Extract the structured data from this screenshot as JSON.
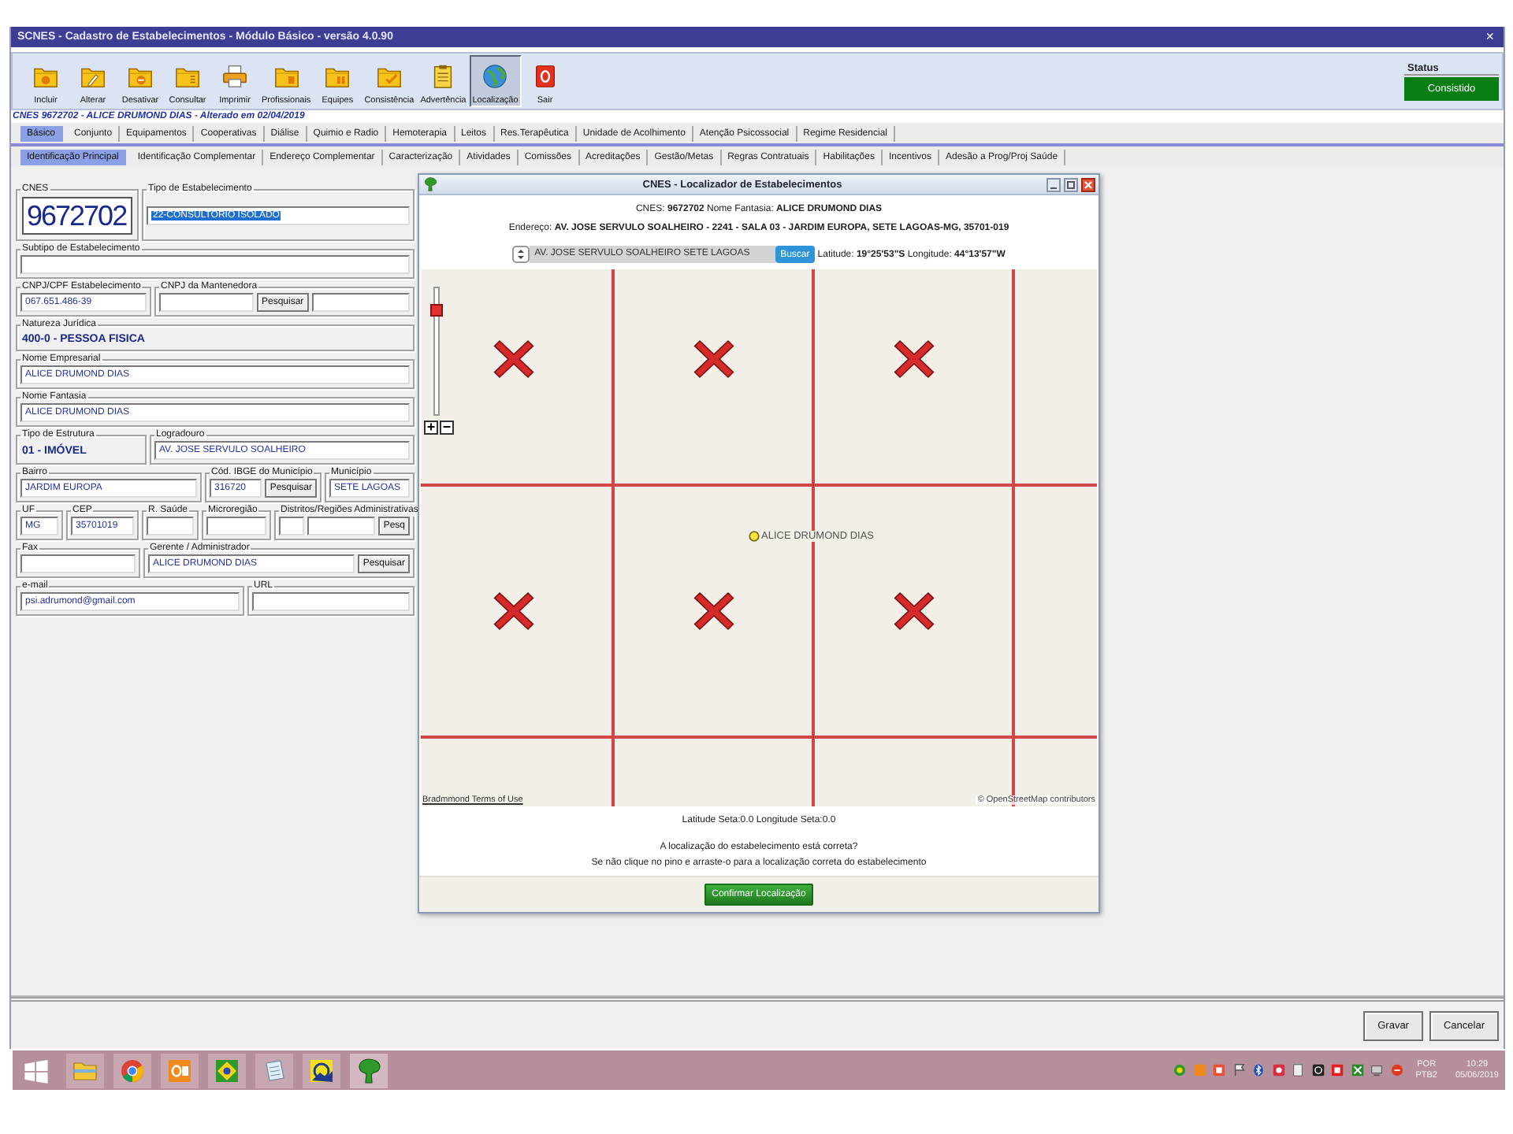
{
  "window": {
    "title": "SCNES - Cadastro de Estabelecimentos - Módulo Básico - versão 4.0.90",
    "close": "×"
  },
  "toolbar": {
    "buttons": [
      {
        "label": "Incluir",
        "selected": false
      },
      {
        "label": "Alterar",
        "selected": false
      },
      {
        "label": "Desativar",
        "selected": false
      },
      {
        "label": "Consultar",
        "selected": false
      },
      {
        "label": "Imprimir",
        "selected": false
      },
      {
        "label": "Profissionais",
        "selected": false
      },
      {
        "label": "Equipes",
        "selected": false
      },
      {
        "label": "Consistência",
        "selected": false
      },
      {
        "label": "Advertência",
        "selected": false
      },
      {
        "label": "Localização",
        "selected": true
      },
      {
        "label": "Sair",
        "selected": false
      }
    ],
    "status": {
      "label": "Status",
      "value": "Consistido"
    }
  },
  "record_line": "CNES 9672702 - ALICE DRUMOND DIAS - Alterado em 02/04/2019",
  "tabs": [
    {
      "label": "Básico",
      "selected": true
    },
    {
      "label": "Conjunto",
      "selected": false
    },
    {
      "label": "Equipamentos",
      "selected": false
    },
    {
      "label": "Cooperativas",
      "selected": false
    },
    {
      "label": "Diálise",
      "selected": false
    },
    {
      "label": "Quimio e Radio",
      "selected": false
    },
    {
      "label": "Hemoterapia",
      "selected": false
    },
    {
      "label": "Leitos",
      "selected": false
    },
    {
      "label": "Res.Terapêutica",
      "selected": false
    },
    {
      "label": "Unidade de Acolhimento",
      "selected": false
    },
    {
      "label": "Atenção Psicossocial",
      "selected": false
    },
    {
      "label": "Regime Residencial",
      "selected": false
    }
  ],
  "subtabs": [
    {
      "label": "Identificação Principal",
      "selected": true
    },
    {
      "label": "Identificação Complementar",
      "selected": false
    },
    {
      "label": "Endereço Complementar",
      "selected": false
    },
    {
      "label": "Caracterização",
      "selected": false
    },
    {
      "label": "Atividades",
      "selected": false
    },
    {
      "label": "Comissões",
      "selected": false
    },
    {
      "label": "Acreditações",
      "selected": false
    },
    {
      "label": "Gestão/Metas",
      "selected": false
    },
    {
      "label": "Regras Contratuais",
      "selected": false
    },
    {
      "label": "Habilitações",
      "selected": false
    },
    {
      "label": "Incentivos",
      "selected": false
    },
    {
      "label": "Adesão a Prog/Proj Saúde",
      "selected": false
    }
  ],
  "form": {
    "groups": [
      {
        "label": "CNES",
        "items": [
          {
            "kind": "big",
            "value": "9672702"
          }
        ]
      },
      {
        "label": "Tipo de Estabelecimento",
        "items": [
          {
            "kind": "field",
            "value": "22-CONSULTORIO ISOLADO",
            "highlighted": true
          }
        ]
      },
      {
        "label": "Subtipo de Estabelecimento",
        "items": [
          {
            "kind": "field"
          }
        ]
      },
      {
        "label": "CNPJ/CPF Estabelecimento",
        "items": [
          {
            "kind": "field",
            "value": "067.651.486-39"
          }
        ]
      },
      {
        "label": "CNPJ da Mantenedora",
        "items": [
          {
            "kind": "field"
          },
          {
            "kind": "button",
            "label": "Pesquisar"
          },
          {
            "kind": "field"
          }
        ]
      },
      {
        "label": "Natureza Jurídica",
        "items": [
          {
            "kind": "text",
            "value": "400-0 - PESSOA FISICA"
          }
        ]
      },
      {
        "label": "Nome Empresarial",
        "items": [
          {
            "kind": "field",
            "value": "ALICE DRUMOND DIAS"
          }
        ]
      },
      {
        "label": "Nome Fantasia",
        "items": [
          {
            "kind": "field",
            "value": "ALICE DRUMOND DIAS"
          }
        ]
      },
      {
        "label": "Tipo de Estrutura",
        "items": [
          {
            "kind": "text",
            "value": "01 - IMÓVEL"
          }
        ]
      },
      {
        "label": "Logradouro",
        "items": [
          {
            "kind": "field",
            "value": "AV. JOSE SERVULO SOALHEIRO"
          }
        ]
      },
      {
        "label": "Bairro",
        "items": [
          {
            "kind": "field",
            "value": "JARDIM EUROPA"
          }
        ]
      },
      {
        "label": "Cód. IBGE do Município",
        "items": [
          {
            "kind": "field",
            "value": "316720"
          },
          {
            "kind": "button",
            "label": "Pesquisar"
          }
        ]
      },
      {
        "label": "Município",
        "items": [
          {
            "kind": "field",
            "value": "SETE LAGOAS"
          }
        ]
      },
      {
        "label": "UF",
        "items": [
          {
            "kind": "field",
            "value": "MG"
          }
        ]
      },
      {
        "label": "CEP",
        "items": [
          {
            "kind": "field",
            "value": "35701019"
          }
        ]
      },
      {
        "label": "R. Saúde",
        "items": [
          {
            "kind": "field"
          }
        ]
      },
      {
        "label": "Microregião",
        "items": [
          {
            "kind": "field"
          }
        ]
      },
      {
        "label": "Distritos/Regiões Administrativas",
        "items": [
          {
            "kind": "field"
          },
          {
            "kind": "field"
          },
          {
            "kind": "button",
            "label": "Pesq"
          }
        ]
      },
      {
        "label": "Fax",
        "items": [
          {
            "kind": "field"
          }
        ]
      },
      {
        "label": "Gerente / Administrador",
        "items": [
          {
            "kind": "field",
            "value": "ALICE DRUMOND DIAS"
          },
          {
            "kind": "button",
            "label": "Pesquisar"
          }
        ]
      },
      {
        "label": "e-mail",
        "items": [
          {
            "kind": "field",
            "value": "psi.adrumond@gmail.com"
          }
        ]
      },
      {
        "label": "URL",
        "items": [
          {
            "kind": "field"
          }
        ]
      }
    ]
  },
  "footer_buttons": [
    "Gravar",
    "Cancelar"
  ],
  "dialog": {
    "title": "CNES - Localizador de Estabelecimentos",
    "summary": "CNES: **9672702** Nome Fantasia: **ALICE DRUMOND DIAS**",
    "address": "Endereço: **AV. JOSE SERVULO SOALHEIRO - 2241 - SALA 03 - JARDIM EUROPA, SETE LAGOAS-MG, 35701-019**",
    "search": {
      "value": "AV. JOSE SERVULO SOALHEIRO SETE LAGOAS",
      "button": "Buscar"
    },
    "coordinates": "Latitude: **19°25'53\"S** Longitude: **44°13'57\"W**",
    "map": {
      "zoom": {
        "level": 0.87,
        "zoom_in": "+",
        "zoom_out": "−"
      },
      "marker": "ALICE DRUMOND DIAS",
      "attribution_left": "Bradmmond Terms of Use",
      "attribution_right": "© OpenStreetMap contributors"
    },
    "arrow_coordinates": "Latitude Seta:0.0 Longitude Seta:0.0",
    "question": "A localização do estabelecimento está correta?",
    "instruction": "Se não clique no pino e arraste-o para a localização correta do estabelecimento",
    "confirm_button": "Confirmar Localização"
  },
  "taskbar": {
    "language": "POR",
    "layout": "PTB2",
    "time": "10:29",
    "date": "05/06/2019"
  }
}
